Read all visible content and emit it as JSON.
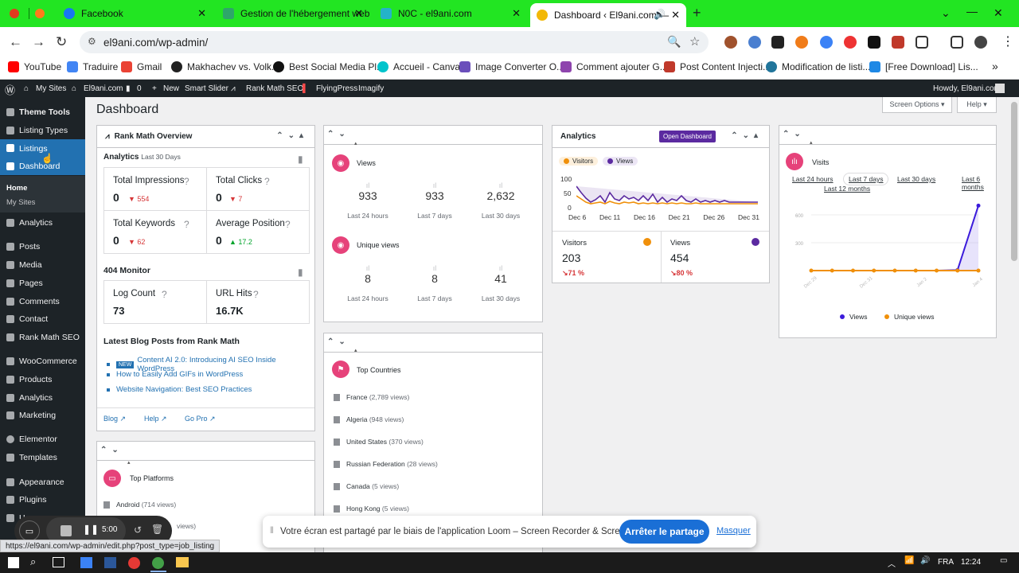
{
  "browser": {
    "tabs": [
      {
        "title": "Facebook",
        "color": "#1877f2"
      },
      {
        "title": "Gestion de l'hébergement web",
        "color": "#2ea66a"
      },
      {
        "title": "N0C - el9ani.com",
        "color": "#24b3c9"
      },
      {
        "title": "Dashboard ‹ El9ani.com —",
        "color": "#f2b807",
        "active": true
      }
    ],
    "new_tab": "+",
    "url": "el9ani.com/wp-admin/",
    "bookmarks": [
      "YouTube",
      "Traduire",
      "Gmail",
      "Makhachev vs. Volk...",
      "Best Social Media Pl...",
      "Accueil - Canva",
      "Image Converter O...",
      "Comment ajouter G...",
      "Post Content Injecti...",
      "Modification de listi...",
      "[Free Download] Lis..."
    ],
    "more": "»"
  },
  "adminbar": {
    "items": [
      "My Sites",
      "El9ani.com",
      "0",
      "New",
      "Smart Slider",
      "Rank Math SEO",
      "FlyingPress",
      "Imagify"
    ],
    "howdy": "Howdy, El9ani.com"
  },
  "sidebar": {
    "items": [
      {
        "label": "Theme Tools",
        "bold": true
      },
      {
        "label": "Listing Types"
      },
      {
        "label": "Listings"
      },
      {
        "label": "Dashboard",
        "current": true
      },
      {
        "label": "Analytics"
      },
      {
        "label": "Posts"
      },
      {
        "label": "Media"
      },
      {
        "label": "Pages"
      },
      {
        "label": "Comments"
      },
      {
        "label": "Contact"
      },
      {
        "label": "Rank Math SEO"
      },
      {
        "label": "WooCommerce"
      },
      {
        "label": "Products"
      },
      {
        "label": "Analytics"
      },
      {
        "label": "Marketing"
      },
      {
        "label": "Elementor"
      },
      {
        "label": "Templates"
      },
      {
        "label": "Appearance"
      },
      {
        "label": "Plugins"
      },
      {
        "label": "Users"
      }
    ],
    "submenu": [
      "Home",
      "My Sites"
    ]
  },
  "page": {
    "title": "Dashboard",
    "screen_options": "Screen Options ▾",
    "help": "Help ▾"
  },
  "rankmath": {
    "title": "Rank Math Overview",
    "analytics_label": "Analytics",
    "analytics_range": "Last 30 Days",
    "stats": [
      {
        "label": "Total Impressions",
        "value": "0",
        "delta": "554",
        "dir": "down"
      },
      {
        "label": "Total Clicks",
        "value": "0",
        "delta": "7",
        "dir": "down"
      },
      {
        "label": "Total Keywords",
        "value": "0",
        "delta": "62",
        "dir": "down"
      },
      {
        "label": "Average Position",
        "value": "0",
        "delta": "17.2",
        "dir": "up"
      }
    ],
    "monitor_title": "404 Monitor",
    "monitor": [
      {
        "label": "Log Count",
        "value": "73"
      },
      {
        "label": "URL Hits",
        "value": "16.7K"
      }
    ],
    "blog_title": "Latest Blog Posts from Rank Math",
    "new_badge": "NEW",
    "posts": [
      "Content AI 2.0: Introducing AI SEO Inside WordPress",
      "How to Easily Add GIFs in WordPress",
      "Website Navigation: Best SEO Practices"
    ],
    "footer": [
      "Blog",
      "Help",
      "Go Pro"
    ]
  },
  "views": {
    "views_title": "Views",
    "views": [
      {
        "n": "933",
        "c": "Last 24 hours"
      },
      {
        "n": "933",
        "c": "Last 7 days"
      },
      {
        "n": "2,632",
        "c": "Last 30 days"
      }
    ],
    "unique_title": "Unique views",
    "unique": [
      {
        "n": "8",
        "c": "Last 24 hours"
      },
      {
        "n": "8",
        "c": "Last 7 days"
      },
      {
        "n": "41",
        "c": "Last 30 days"
      }
    ]
  },
  "countries": {
    "title": "Top Countries",
    "items": [
      {
        "name": "France",
        "views": "(2,789 views)"
      },
      {
        "name": "Algeria",
        "views": "(948 views)"
      },
      {
        "name": "United States",
        "views": "(370 views)"
      },
      {
        "name": "Russian Federation",
        "views": "(28 views)"
      },
      {
        "name": "Canada",
        "views": "(5 views)"
      },
      {
        "name": "Hong Kong",
        "views": "(5 views)"
      }
    ]
  },
  "platforms": {
    "title": "Top Platforms",
    "items": [
      {
        "name": "Android",
        "views": "(714 views)"
      },
      {
        "name": "",
        "views": "views)"
      }
    ]
  },
  "analytics_widget": {
    "title": "Analytics",
    "open": "Open Dashboard",
    "legend": [
      "Visitors",
      "Views"
    ],
    "y_ticks": [
      "100",
      "50",
      "0"
    ],
    "x_ticks": [
      "Dec 6",
      "Dec 11",
      "Dec 16",
      "Dec 21",
      "Dec 26",
      "Dec 31"
    ],
    "visitors": {
      "label": "Visitors",
      "value": "203",
      "change": "↘71 %"
    },
    "views": {
      "label": "Views",
      "value": "454",
      "change": "↘80 %"
    },
    "colors": {
      "visitors": "#f0900a",
      "views": "#5b2aa0"
    }
  },
  "chart_data": {
    "type": "line",
    "title": "Visits",
    "x": [
      "Dec 29",
      "Dec 31",
      "Jan 2",
      "Jan 4"
    ],
    "series": [
      {
        "name": "Views",
        "values": [
          0,
          0,
          0,
          0,
          0,
          0,
          0,
          5,
          700
        ]
      },
      {
        "name": "Unique views",
        "values": [
          0,
          0,
          0,
          0,
          0,
          0,
          0,
          0,
          0
        ]
      }
    ],
    "y_ticks": [
      "600",
      "300"
    ],
    "ranges": [
      "Last 24 hours",
      "Last 7 days",
      "Last 30 days",
      "Last 6 months",
      "Last 12 months"
    ]
  },
  "loom": {
    "message": "Votre écran est partagé par le biais de l'application Loom – Screen Recorder & Screen Capture.",
    "stop": "Arrêter le partage",
    "hide": "Masquer",
    "time": "5:00"
  },
  "statusbar": "https://el9ani.com/wp-admin/edit.php?post_type=job_listing",
  "taskbar": {
    "lang": "FRA",
    "time": "12:24"
  }
}
